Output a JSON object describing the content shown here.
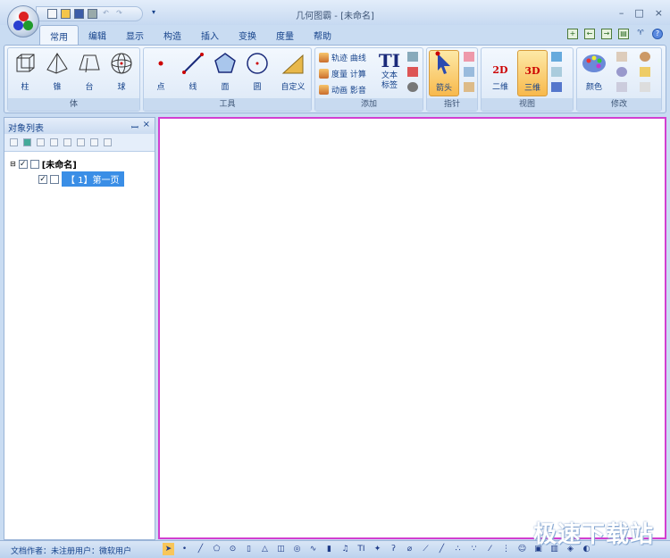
{
  "window": {
    "title": "几何图霸 - [未命名]",
    "minimize": "–",
    "maximize": "□",
    "close": "×"
  },
  "qat": [
    "new-icon",
    "open-icon",
    "save-icon",
    "print-icon",
    "undo-icon",
    "redo-icon"
  ],
  "tabs": [
    "常用",
    "编辑",
    "显示",
    "构造",
    "插入",
    "变换",
    "度量",
    "帮助"
  ],
  "active_tab": "常用",
  "ribbon": {
    "body": {
      "label": "体",
      "items": [
        "柱",
        "锥",
        "台",
        "球"
      ]
    },
    "tools": {
      "label": "工具",
      "items": [
        "点",
        "线",
        "面",
        "圆",
        "自定义"
      ]
    },
    "add": {
      "label": "添加",
      "small": [
        "轨迹 曲线",
        "度量 计算",
        "动画 影音"
      ],
      "text_label": "文本\n标签",
      "text_glyph": "TI"
    },
    "pointer": {
      "label": "指针",
      "arrow": "箭头"
    },
    "view": {
      "label": "视图",
      "items": [
        "二维",
        "三维"
      ],
      "active": "三维",
      "badge2d": "2D",
      "badge3d": "3D"
    },
    "modify": {
      "label": "修改",
      "color": "颜色"
    }
  },
  "panel": {
    "title": "对象列表",
    "pin": "ꟷ",
    "close": "×",
    "root": "[未命名]",
    "page": "【 1】第一页"
  },
  "status": {
    "text": "文档作者：未注册用户：微软用户"
  },
  "bottom_tools": [
    "arrow",
    "•",
    "╱",
    "⬠",
    "⊙",
    "▯",
    "△",
    "◫",
    "◎",
    "∿",
    "▮",
    "♫",
    "TI",
    "✦",
    "ʔ",
    "⌀",
    "⟋",
    "╱",
    "∴",
    "∵",
    "⁄",
    "⋮",
    "☺",
    "▣",
    "▥",
    "◈",
    "◐"
  ],
  "watermark": "极速下载站",
  "colors": {
    "accent": "#15428b",
    "canvas_border": "#d23fd0",
    "highlight": "#f8b94c"
  }
}
